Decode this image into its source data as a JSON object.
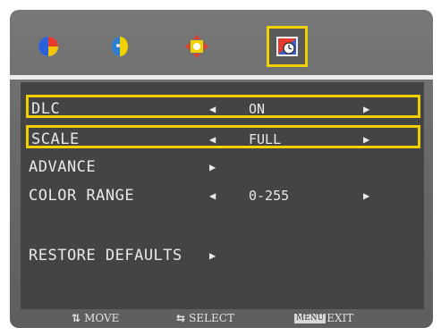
{
  "tabs": [
    {
      "icon": "color-icon"
    },
    {
      "icon": "picture-icon"
    },
    {
      "icon": "position-icon"
    },
    {
      "icon": "setup-icon",
      "active": true
    }
  ],
  "menu": {
    "dlc": {
      "label": "DLC",
      "value": "ON"
    },
    "scale": {
      "label": "SCALE",
      "value": "FULL"
    },
    "advance": {
      "label": "ADVANCE"
    },
    "color_range": {
      "label": "COLOR RANGE",
      "value": "0-255"
    },
    "restore": {
      "label": "RESTORE DEFAULTS"
    }
  },
  "arrows": {
    "left": "◀",
    "right": "▶"
  },
  "hints": {
    "move_icon": "⇅",
    "move": "MOVE",
    "select_icon": "⇆",
    "select": "SELECT",
    "menu_key": "MENU",
    "exit": "EXIT"
  },
  "colors": {
    "highlight": "#f2d000",
    "panel": "#444444",
    "frame": "#6a6a6a"
  }
}
